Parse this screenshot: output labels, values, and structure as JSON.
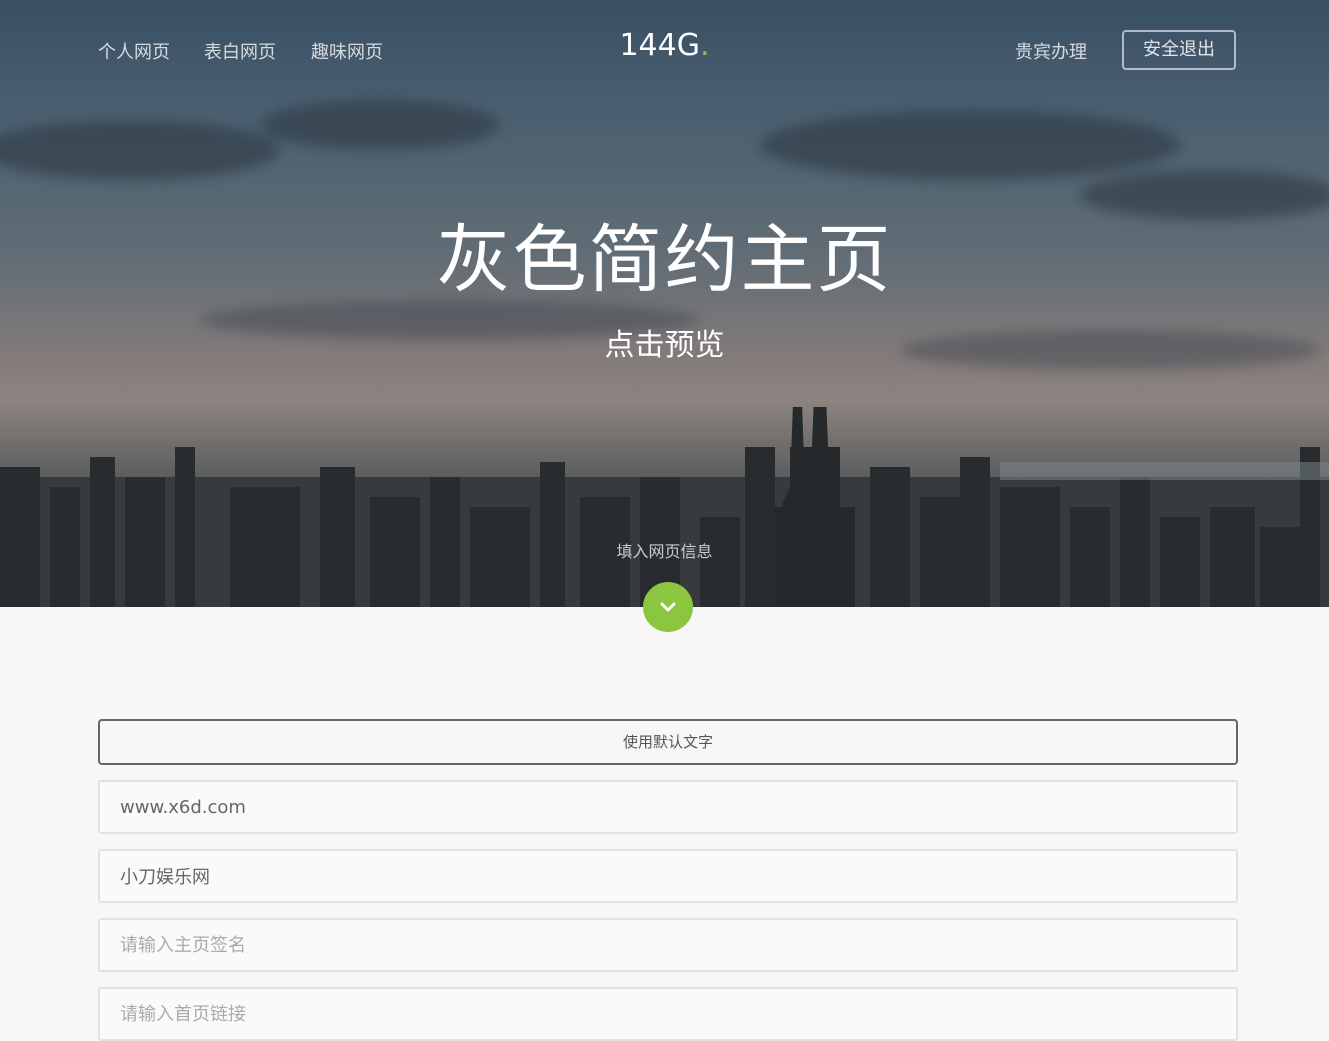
{
  "nav": {
    "left_links": [
      "个人网页",
      "表白网页",
      "趣味网页"
    ],
    "brand": "144G",
    "brand_dot": ".",
    "vip_link": "贵宾办理",
    "logout_button": "安全退出"
  },
  "hero": {
    "title": "灰色简约主页",
    "subtitle": "点击预览",
    "hint": "填入网页信息",
    "scroll_icon": "chevron-down-icon"
  },
  "form": {
    "default_text_button": "使用默认文字",
    "fields": [
      {
        "value": "www.x6d.com",
        "placeholder": ""
      },
      {
        "value": "小刀娱乐网",
        "placeholder": ""
      },
      {
        "value": "",
        "placeholder": "请输入主页签名"
      },
      {
        "value": "",
        "placeholder": "请输入首页链接"
      }
    ]
  },
  "colors": {
    "accent": "#8cc63f",
    "background": "#f7f7f7"
  }
}
